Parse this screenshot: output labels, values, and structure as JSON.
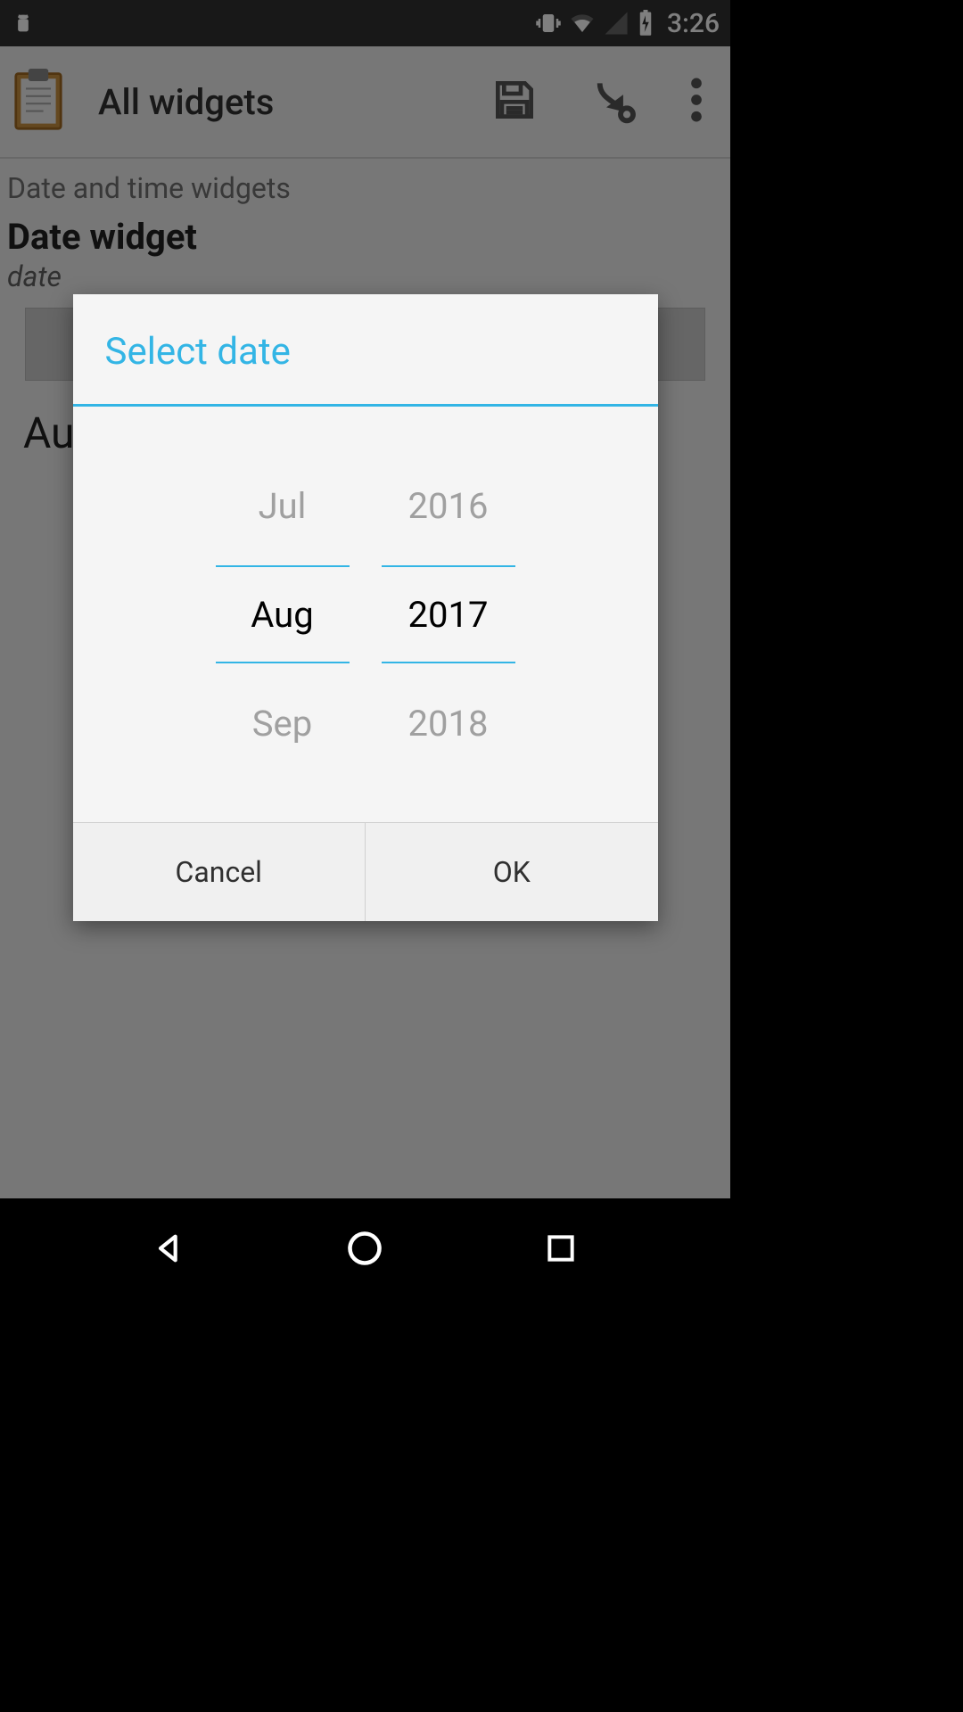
{
  "status_bar": {
    "time": "3:26"
  },
  "app_bar": {
    "title": "All widgets"
  },
  "content": {
    "section_label": "Date and time widgets",
    "widget_title": "Date widget",
    "widget_sub": "date",
    "result_prefix": "Au"
  },
  "dialog": {
    "title": "Select date",
    "month": {
      "prev": "Jul",
      "selected": "Aug",
      "next": "Sep"
    },
    "year": {
      "prev": "2016",
      "selected": "2017",
      "next": "2018"
    },
    "cancel": "Cancel",
    "ok": "OK"
  }
}
